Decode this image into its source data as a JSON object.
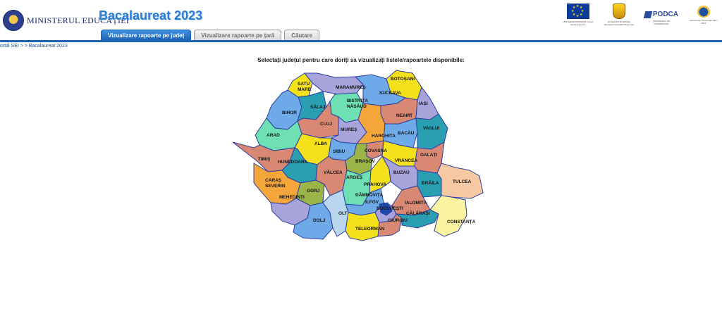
{
  "header": {
    "ministry_name": "MINISTERUL EDUCAȚIEI",
    "app_title": "Bacalaureat 2023",
    "tabs": [
      {
        "label": "Vizualizare rapoarte pe județ",
        "active": true
      },
      {
        "label": "Vizualizare rapoarte pe țară",
        "active": false
      },
      {
        "label": "Căutare",
        "active": false
      }
    ],
    "partners": [
      {
        "name": "eu-flag",
        "label": "UNIUNEA EUROPEANĂ Fondul Social European"
      },
      {
        "name": "coat-of-arms",
        "label": "GUVERNUL ROMÂNIEI Ministerul Dezvoltării Regionale și Administrației Publice"
      },
      {
        "name": "podca",
        "label": "PODCA",
        "caption": "PROGRAMUL DE GUVERNANȚĂ"
      },
      {
        "name": "programme",
        "label": "Instrumente Structurale 2007-2013"
      }
    ],
    "colors": {
      "accent": "#1a63b6",
      "title": "#2a7bd6"
    }
  },
  "breadcrumb": "ortal SEI > > Bacalaureat 2023",
  "instruction": "Selectați județul pentru care doriți sa vizualizați listele/rapoartele disponibile:",
  "counties": [
    {
      "id": "satu-mare",
      "name": "SATU MARE",
      "color": "#f5e11a"
    },
    {
      "id": "maramures",
      "name": "MARAMUREȘ",
      "color": "#a9a3dc"
    },
    {
      "id": "botosani",
      "name": "BOTOȘANI",
      "color": "#f5e11a"
    },
    {
      "id": "suceava",
      "name": "SUCEAVA",
      "color": "#6eaae8"
    },
    {
      "id": "bihor",
      "name": "BIHOR",
      "color": "#6eaae8"
    },
    {
      "id": "salaj",
      "name": "SĂLAJ",
      "color": "#2a9fb2"
    },
    {
      "id": "bistrita-nasaud",
      "name": "BISTRIȚA NĂSĂUD",
      "color": "#6fe0b4"
    },
    {
      "id": "neamt",
      "name": "NEAMȚ",
      "color": "#d98873"
    },
    {
      "id": "iasi",
      "name": "IAȘI",
      "color": "#a9a3dc"
    },
    {
      "id": "cluj",
      "name": "CLUJ",
      "color": "#d98873"
    },
    {
      "id": "mures",
      "name": "MUREȘ",
      "color": "#a9a3dc"
    },
    {
      "id": "harghita",
      "name": "HARGHITA",
      "color": "#f5a63a"
    },
    {
      "id": "bacau",
      "name": "BACĂU",
      "color": "#6eaae8"
    },
    {
      "id": "vaslui",
      "name": "VASLUI",
      "color": "#2a9fb2"
    },
    {
      "id": "arad",
      "name": "ARAD",
      "color": "#6fe0b4"
    },
    {
      "id": "alba",
      "name": "ALBA",
      "color": "#f5e11a"
    },
    {
      "id": "sibiu",
      "name": "SIBIU",
      "color": "#6eaae8"
    },
    {
      "id": "covasna",
      "name": "COVASNA",
      "color": "#d98873"
    },
    {
      "id": "vrancea",
      "name": "VRANCEA",
      "color": "#f5e11a"
    },
    {
      "id": "galati",
      "name": "GALAȚI",
      "color": "#d98873"
    },
    {
      "id": "timis",
      "name": "TIMIȘ",
      "color": "#d98873"
    },
    {
      "id": "hunedoara",
      "name": "HUNEDOARA",
      "color": "#2a9fb2"
    },
    {
      "id": "brasov",
      "name": "BRAȘOV",
      "color": "#9bb448"
    },
    {
      "id": "valcea",
      "name": "VÂLCEA",
      "color": "#d98873"
    },
    {
      "id": "arges",
      "name": "ARGEȘ",
      "color": "#6fe0b4"
    },
    {
      "id": "prahova",
      "name": "PRAHOVA",
      "color": "#f5e11a"
    },
    {
      "id": "buzau",
      "name": "BUZĂU",
      "color": "#a9a3dc"
    },
    {
      "id": "braila",
      "name": "BRĂILA",
      "color": "#2a9fb2"
    },
    {
      "id": "tulcea",
      "name": "TULCEA",
      "color": "#f7c9a3"
    },
    {
      "id": "caras-severin",
      "name": "CARAȘ SEVERIN",
      "color": "#f5a63a"
    },
    {
      "id": "gorj",
      "name": "GORJ",
      "color": "#9bb448"
    },
    {
      "id": "mehedinti",
      "name": "MEHEDINȚI",
      "color": "#a9a3dc"
    },
    {
      "id": "dambovita",
      "name": "DÂMBOVIȚA",
      "color": "#6eaae8"
    },
    {
      "id": "ilfov",
      "name": "ILFOV",
      "color": "#a9a3dc"
    },
    {
      "id": "bucuresti",
      "name": "BUCUREȘTI",
      "color": "#1f4ba8"
    },
    {
      "id": "ialomita",
      "name": "IALOMIȚA",
      "color": "#d98873"
    },
    {
      "id": "dolj",
      "name": "DOLJ",
      "color": "#6eaae8"
    },
    {
      "id": "olt",
      "name": "OLT",
      "color": "#b9d8f0"
    },
    {
      "id": "teleorman",
      "name": "TELEORMAN",
      "color": "#f5e11a"
    },
    {
      "id": "giurgiu",
      "name": "GIURGIU",
      "color": "#d98873"
    },
    {
      "id": "calarasi",
      "name": "CĂLĂRAȘI",
      "color": "#2a9fb2"
    },
    {
      "id": "constanta",
      "name": "CONSTANȚA",
      "color": "#faf3a0"
    }
  ]
}
